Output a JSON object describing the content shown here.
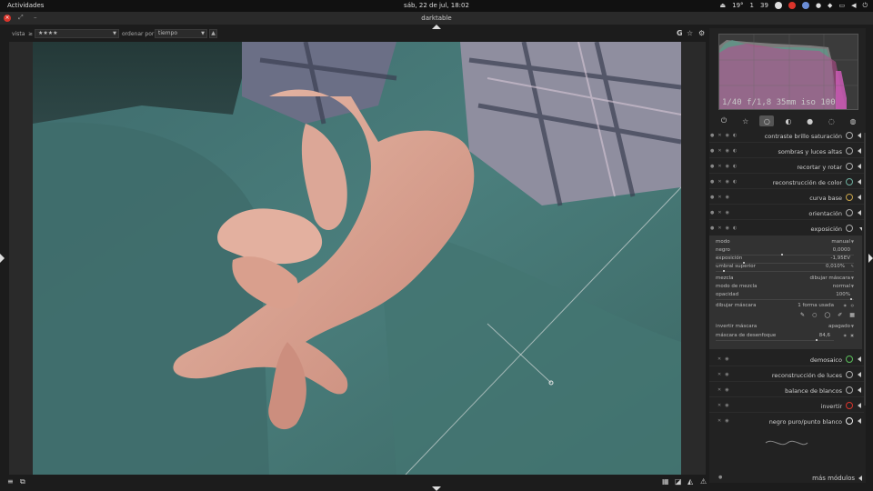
{
  "system_bar": {
    "activities": "Actividades",
    "clock": "sáb, 22 de jul, 18:02",
    "tray": [
      "19°",
      "1",
      "39"
    ]
  },
  "window": {
    "title": "darktable"
  },
  "filter_bar": {
    "view_label": "vista",
    "view_value": "★★★★",
    "sort_label": "ordenar por",
    "sort_value": "tiempo",
    "sort_dir": "▲",
    "icon_g": "G"
  },
  "histogram": {
    "info": "1/40 f/1,8 35mm iso 100"
  },
  "modules": [
    {
      "name": "contraste brillo saturación"
    },
    {
      "name": "sombras y luces altas"
    },
    {
      "name": "recortar y rotar"
    },
    {
      "name": "reconstrucción de color"
    },
    {
      "name": "curva base"
    },
    {
      "name": "orientación"
    },
    {
      "name": "exposición"
    }
  ],
  "exposure_panel": {
    "mode_label": "modo",
    "mode_value": "manual",
    "black_label": "negro",
    "black_value": "0,0000",
    "exposure_label": "exposición",
    "exposure_value": "-1,95EV",
    "threshold_label": "umbral superior",
    "threshold_value": "0,010%",
    "blend_label": "mezcla",
    "blend_value": "dibujar máscara",
    "blendmode_label": "modo de mezcla",
    "blendmode_value": "normal",
    "opacity_label": "opacidad",
    "opacity_value": "100%",
    "drawmask_label": "dibujar máscara",
    "drawmask_value": "1 forma usada",
    "invert_label": "invertir máscara",
    "invert_value": "apagado",
    "blur_label": "máscara de desenfoque",
    "blur_value": "84,6"
  },
  "modules_after": [
    {
      "name": "demosaico"
    },
    {
      "name": "reconstrucción de luces"
    },
    {
      "name": "balance de blancos"
    },
    {
      "name": "invertir"
    },
    {
      "name": "negro puro/punto blanco"
    }
  ],
  "more_modules": "más módulos",
  "colors": {
    "accent_red": "#d9342b",
    "panel": "#222222",
    "expanded_panel": "#323232"
  }
}
